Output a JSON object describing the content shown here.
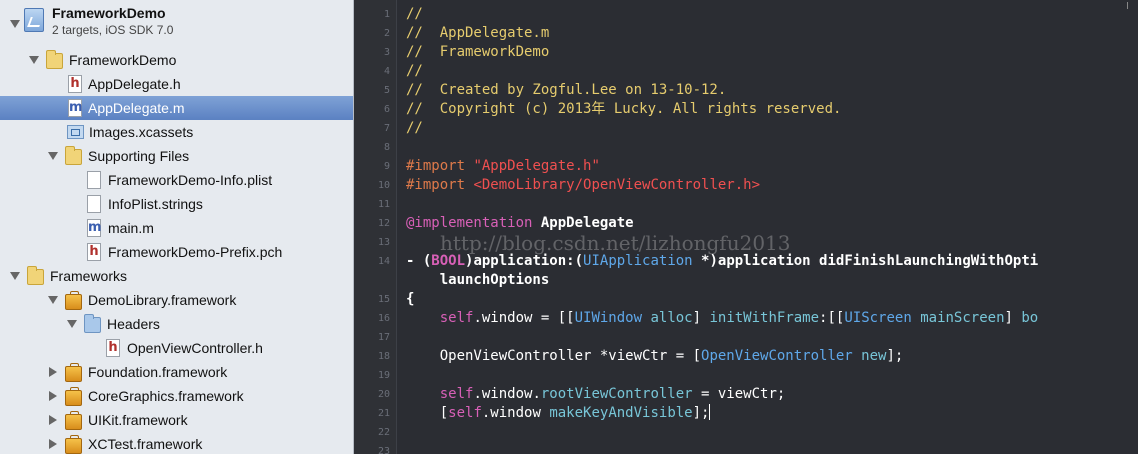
{
  "navigator": {
    "project": {
      "name": "FrameworkDemo",
      "subtitle": "2 targets, iOS SDK 7.0"
    },
    "items": [
      {
        "label": "FrameworkDemo",
        "icon": "folder-icon"
      },
      {
        "label": "AppDelegate.h",
        "icon": "header-file-icon",
        "glyph": "h"
      },
      {
        "label": "AppDelegate.m",
        "icon": "source-file-icon",
        "glyph": "m",
        "selected": true
      },
      {
        "label": "Images.xcassets",
        "icon": "asset-catalog-icon"
      },
      {
        "label": "Supporting Files",
        "icon": "folder-icon"
      },
      {
        "label": "FrameworkDemo-Info.plist",
        "icon": "plist-file-icon"
      },
      {
        "label": "InfoPlist.strings",
        "icon": "strings-file-icon"
      },
      {
        "label": "main.m",
        "icon": "source-file-icon",
        "glyph": "m"
      },
      {
        "label": "FrameworkDemo-Prefix.pch",
        "icon": "header-file-icon",
        "glyph": "h"
      },
      {
        "label": "Frameworks",
        "icon": "folder-icon"
      },
      {
        "label": "DemoLibrary.framework",
        "icon": "framework-icon"
      },
      {
        "label": "Headers",
        "icon": "folder-icon"
      },
      {
        "label": "OpenViewController.h",
        "icon": "header-file-icon",
        "glyph": "h"
      },
      {
        "label": "Foundation.framework",
        "icon": "framework-icon"
      },
      {
        "label": "CoreGraphics.framework",
        "icon": "framework-icon"
      },
      {
        "label": "UIKit.framework",
        "icon": "framework-icon"
      },
      {
        "label": "XCTest.framework",
        "icon": "framework-icon"
      }
    ]
  },
  "editor": {
    "line_numbers": [
      "1",
      "2",
      "3",
      "4",
      "5",
      "6",
      "7",
      "8",
      "9",
      "10",
      "11",
      "12",
      "13",
      "14",
      "15",
      "16",
      "17",
      "18",
      "19",
      "20",
      "21",
      "22",
      "23"
    ],
    "lines": {
      "l1": "//",
      "l2": "//  AppDelegate.m",
      "l3": "//  FrameworkDemo",
      "l4": "//",
      "l5": "//  Created by Zogful.Lee on 13-10-12.",
      "l6": "//  Copyright (c) 2013年 Lucky. All rights reserved.",
      "l7": "//",
      "l9a": "#import ",
      "l9b": "\"AppDelegate.h\"",
      "l10a": "#import ",
      "l10b": "<DemoLibrary/OpenViewController.h>",
      "l12a": "@implementation",
      "l12b": " AppDelegate",
      "l14a": "- (",
      "l14b": "BOOL",
      "l14c": ")application:(",
      "l14d": "UIApplication",
      "l14e": " *)application didFinishLaunchingWithOpti",
      "l14f": "    launchOptions",
      "l15": "{",
      "l16a": "    ",
      "l16b": "self",
      "l16c": ".window = [[",
      "l16d": "UIWindow",
      "l16e": " alloc",
      "l16f": "] ",
      "l16g": "initWithFrame",
      "l16h": ":[[",
      "l16i": "UIScreen",
      "l16j": " mainScreen",
      "l16k": "] ",
      "l16l": "bo",
      "l18a": "    OpenViewController *viewCtr = [",
      "l18b": "OpenViewController",
      "l18c": " new",
      "l18d": "];",
      "l20a": "    ",
      "l20b": "self",
      "l20c": ".window.",
      "l20d": "rootViewController",
      "l20e": " = viewCtr;",
      "l21a": "    [",
      "l21b": "self",
      "l21c": ".window ",
      "l21d": "makeKeyAndVisible",
      "l21e": "];"
    },
    "watermark": "http://blog.csdn.net/lizhongfu2013"
  }
}
